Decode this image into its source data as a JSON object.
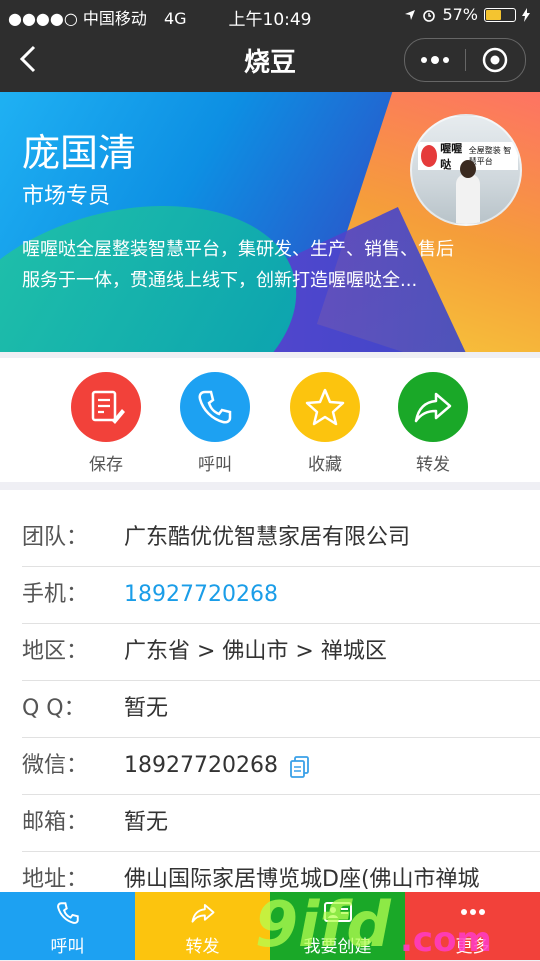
{
  "status_bar": {
    "carrier": "●●●●○ 中国移动",
    "network": "4G",
    "time": "上午10:49",
    "battery": "57%",
    "battery_level": 0.57
  },
  "nav": {
    "title": "烧豆"
  },
  "profile": {
    "name": "庞国清",
    "position": "市场专员",
    "description_line1": "喔喔哒全屋整装智慧平台，集研发、生产、销售、售后",
    "description_line2": "服务于一体，贯通线上线下，创新打造喔喔哒全...",
    "avatar_sign_brand": "喔喔哒",
    "avatar_sign_text": "全屋整装 智慧平台"
  },
  "actions": [
    {
      "label": "保存",
      "color": "#f2413a",
      "icon": "save-icon"
    },
    {
      "label": "呼叫",
      "color": "#1da1f2",
      "icon": "phone-icon"
    },
    {
      "label": "收藏",
      "color": "#fcc40e",
      "icon": "star-icon"
    },
    {
      "label": "转发",
      "color": "#1aa828",
      "icon": "forward-icon"
    }
  ],
  "info": {
    "team": {
      "key": "团队：",
      "value": "广东酷优优智慧家居有限公司"
    },
    "phone": {
      "key": "手机：",
      "value": "18927720268"
    },
    "region": {
      "key": "地区：",
      "value": "广东省 > 佛山市 > 禅城区"
    },
    "qq": {
      "key": "Q Q：",
      "value": "暂无"
    },
    "wechat": {
      "key": "微信：",
      "value": "18927720268"
    },
    "email": {
      "key": "邮箱：",
      "value": "暂无"
    },
    "address": {
      "key": "地址：",
      "value": "佛山国际家居博览城D座(佛山市禅城"
    }
  },
  "bottom_bar": [
    {
      "label": "呼叫",
      "color": "#1da1f2",
      "icon": "phone-icon"
    },
    {
      "label": "转发",
      "color": "#fcc40e",
      "icon": "forward-icon"
    },
    {
      "label": "我要创建",
      "color": "#1aa828",
      "icon": "card-icon"
    },
    {
      "label": "更多",
      "color": "#f2413a",
      "icon": "more-icon"
    }
  ],
  "watermark": {
    "text": "9ifd",
    "suffix": ".com"
  }
}
